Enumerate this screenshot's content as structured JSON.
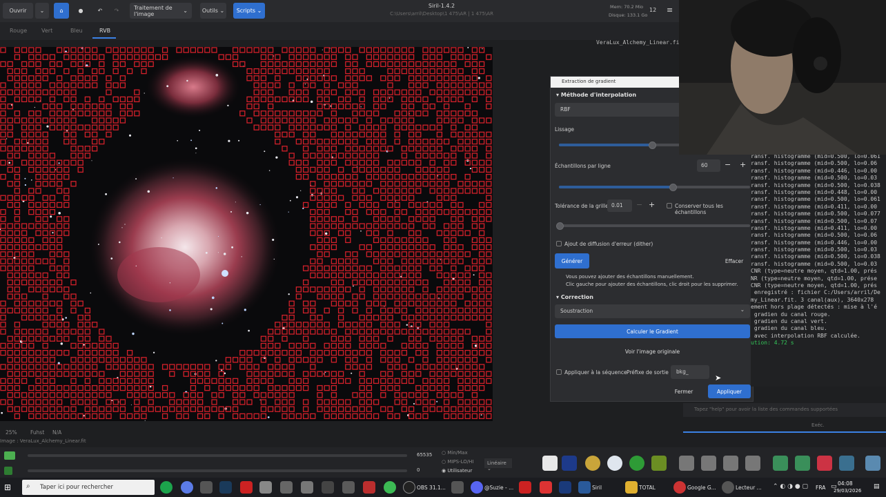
{
  "header": {
    "open_label": "Ouvrir",
    "image_processing_label": "Traitement de l'image",
    "tools_label": "Outils",
    "scripts_label": "Scripts",
    "app_title": "Siril-1.4.2",
    "subtitle": "C:\\Users\\arril\\Desktop\\1 475\\AR | 1 475\\AR",
    "mem_label": "Mem: 70.2 Mio",
    "disk_label": "Disque: 133.1 Go",
    "threads": "12"
  },
  "tabs": [
    {
      "label": "Rouge"
    },
    {
      "label": "Vert"
    },
    {
      "label": "Bleu"
    },
    {
      "label": "RVB"
    }
  ],
  "filename_display": "VeraLux_Alchemy_Linear.fit",
  "dialog": {
    "title": "Extraction de gradient",
    "interp_section": "Méthode d'interpolation",
    "interp_value": "RBF",
    "smoothing_label": "Lissage",
    "samples_label": "Échantillons par ligne",
    "samples_value": "60",
    "tolerance_label": "Tolérance de la grille",
    "tolerance_value": "0.01",
    "keep_samples_label": "Conserver tous les échantillons",
    "dither_label": "Ajout de diffusion d'erreur (dither)",
    "generate_label": "Générer",
    "clear_label": "Effacer",
    "info_line1": "Vous pouvez ajouter des échantillons manuellement.",
    "info_line2": "Clic gauche pour ajouter des échantillons, clic droit pour les supprimer.",
    "correction_section": "Correction",
    "correction_value": "Soustraction",
    "compute_label": "Calculer le Gradient",
    "view_original_label": "Voir l'image originale",
    "apply_sequence_label": "Appliquer à la séquence",
    "prefix_label": "Préfixe de sortie :",
    "prefix_value": "bkg_",
    "close_label": "Fermer",
    "apply_label": "Appliquer"
  },
  "console": {
    "lines": [
      {
        "text": "ransf. histogramme (mid=0.500, lo=0.061"
      },
      {
        "text": "ransf. histogramme (mid=0.500, lo=0.06"
      },
      {
        "text": "ransf. histogramme (mid=0.446, lo=0.00"
      },
      {
        "text": "ransf. histogramme (mid=0.500, lo=0.03"
      },
      {
        "text": "ransf. histogramme (mid=0.500, lo=0.038"
      },
      {
        "text": "ransf. histogramme (mid=0.448, lo=0.00"
      },
      {
        "text": "ransf. histogramme (mid=0.500, lo=0.061"
      },
      {
        "text": "ransf. histogramme (mid=0.411, lo=0.00"
      },
      {
        "text": "ransf. histogramme (mid=0.500, lo=0.077"
      },
      {
        "text": "ransf. histogramme (mid=0.500, lo=0.07"
      },
      {
        "text": "ransf. histogramme (mid=0.411, lo=0.00"
      },
      {
        "text": "ransf. histogramme (mid=0.500, lo=0.06"
      },
      {
        "text": "ransf. histogramme (mid=0.446, lo=0.00"
      },
      {
        "text": "ransf. histogramme (mid=0.500, lo=0.03"
      },
      {
        "text": "ransf. histogramme (mid=0.500, lo=0.038"
      },
      {
        "text": "ransf. histogramme (mid=0.500, lo=0.03"
      },
      {
        "text": "CNR (type=neutre moyen, qtd=1.00, prés"
      },
      {
        "text": "NR (type=neutre moyen, qtd=1.00, prése"
      },
      {
        "text": "CNR (type=neutre moyen, qtd=1.00, prés"
      },
      {
        "text": " enregistré : fichier C:/Users/arril/De"
      },
      {
        "text": "my_Linear.fit. 3 canal(aux), 3640x278"
      },
      {
        "text": "ement hors plage détectés : mise à l'é"
      },
      {
        "text": " gradien du canal rouge."
      },
      {
        "text": " gradien du canal vert."
      },
      {
        "text": " gradien du canal bleu."
      },
      {
        "text": " avec interpolation RBF calculée."
      },
      {
        "text": "ution: 4.72 s",
        "green": true
      }
    ],
    "input_placeholder": "Tapez \"help\" pour avoir la liste des commandes supportées",
    "exec_label": "Exéc."
  },
  "status": {
    "zoom": "25%",
    "wcs": "Fuhst",
    "na": "N/A",
    "image_label": "Image : VeraLux_Alchemy_Linear.fit"
  },
  "bottom": {
    "max_value": "65535",
    "min_value": "0",
    "opt_minmax": "Min/Max",
    "opt_mips": "MIPS-LO/HI",
    "opt_user": "Utilisateur",
    "stretch": "Linéaire"
  },
  "taskbar": {
    "search_placeholder": "Taper ici pour rechercher",
    "obs": "OBS 31.1...",
    "suzie": "@Suzie - ...",
    "siril": "Siril",
    "total": "TOTAL",
    "google": "Google G...",
    "lecteur": "Lecteur ...",
    "lang": "FRA",
    "time": "04:08",
    "date": "29/03/2026"
  },
  "colors": {
    "accent": "#2f6fcf",
    "sample_box": "#d3202a",
    "success": "#34c759"
  }
}
